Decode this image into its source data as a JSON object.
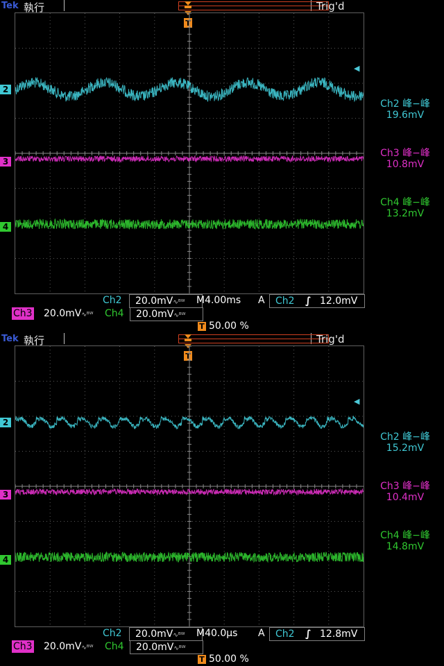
{
  "colors": {
    "ch2": "#40c8d4",
    "ch3": "#e030c8",
    "ch4": "#30c830",
    "trigger": "#f08a1c",
    "grid": "#5a5a5a"
  },
  "icons": {
    "trigger_marker": "T-marker-icon",
    "edge": "rising-edge-icon",
    "probe": "bandwidth-icon"
  },
  "screens": [
    {
      "brand": "Tek",
      "mode": "執行",
      "status": "Trig'd",
      "channel_markers": [
        "2",
        "3",
        "4"
      ],
      "measurements": [
        {
          "label": "Ch2 峰−峰",
          "value": "19.6mV"
        },
        {
          "label": "Ch3 峰−峰",
          "value": "10.8mV"
        },
        {
          "label": "Ch4 峰−峰",
          "value": "13.2mV"
        }
      ],
      "ch2_scale": {
        "name": "Ch2",
        "value": "20.0mV"
      },
      "ch3_scale": {
        "name": "Ch3",
        "value": "20.0mV"
      },
      "ch4_scale": {
        "name": "Ch4",
        "value": "20.0mV"
      },
      "timebase": "M4.00ms",
      "trigger": {
        "mode": "A",
        "source": "Ch2",
        "level": "12.0mV"
      },
      "position": "50.00 %"
    },
    {
      "brand": "Tek",
      "mode": "執行",
      "status": "Trig'd",
      "channel_markers": [
        "2",
        "3",
        "4"
      ],
      "measurements": [
        {
          "label": "Ch2 峰−峰",
          "value": "15.2mV"
        },
        {
          "label": "Ch3 峰−峰",
          "value": "10.4mV"
        },
        {
          "label": "Ch4 峰−峰",
          "value": "14.8mV"
        }
      ],
      "ch2_scale": {
        "name": "Ch2",
        "value": "20.0mV"
      },
      "ch3_scale": {
        "name": "Ch3",
        "value": "20.0mV"
      },
      "ch4_scale": {
        "name": "Ch4",
        "value": "20.0mV"
      },
      "timebase": "M40.0µs",
      "trigger": {
        "mode": "A",
        "source": "Ch2",
        "level": "12.8mV"
      },
      "position": "50.00 %"
    }
  ]
}
